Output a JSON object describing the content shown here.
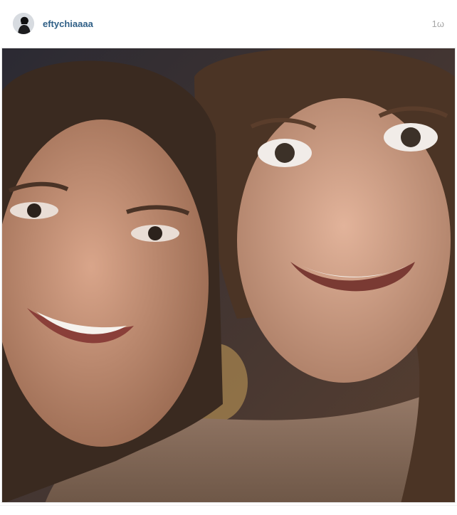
{
  "post": {
    "username": "eftychiaaaa",
    "timestamp": "1ω",
    "avatar_icon": "profile-avatar",
    "photo_icon": "selfie-photo"
  }
}
